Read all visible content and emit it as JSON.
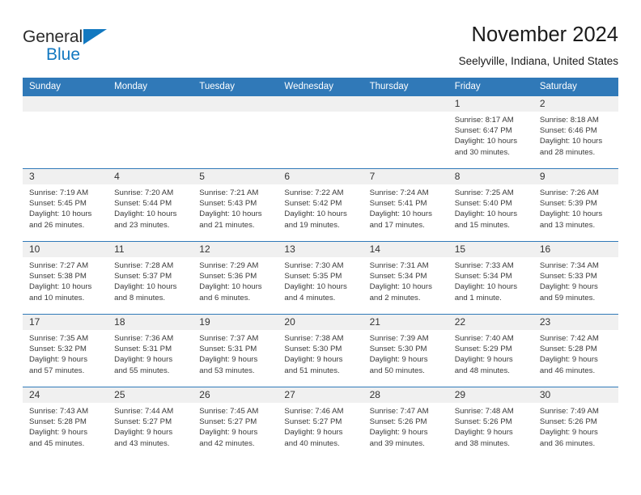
{
  "brand": {
    "name_part1": "General",
    "name_part2": "Blue",
    "triangle_color": "#1278c0"
  },
  "header": {
    "title": "November 2024",
    "subtitle": "Seelyville, Indiana, United States",
    "accent_color": "#3079b8"
  },
  "weekday_headers": [
    "Sunday",
    "Monday",
    "Tuesday",
    "Wednesday",
    "Thursday",
    "Friday",
    "Saturday"
  ],
  "labels": {
    "sunrise_prefix": "Sunrise:",
    "sunset_prefix": "Sunset:",
    "daylight_prefix": "Daylight:"
  },
  "weeks": [
    [
      {
        "day": "",
        "sunrise": "",
        "sunset": "",
        "daylight_line1": "",
        "daylight_line2": "",
        "empty": true
      },
      {
        "day": "",
        "sunrise": "",
        "sunset": "",
        "daylight_line1": "",
        "daylight_line2": "",
        "empty": true
      },
      {
        "day": "",
        "sunrise": "",
        "sunset": "",
        "daylight_line1": "",
        "daylight_line2": "",
        "empty": true
      },
      {
        "day": "",
        "sunrise": "",
        "sunset": "",
        "daylight_line1": "",
        "daylight_line2": "",
        "empty": true
      },
      {
        "day": "",
        "sunrise": "",
        "sunset": "",
        "daylight_line1": "",
        "daylight_line2": "",
        "empty": true
      },
      {
        "day": "1",
        "sunrise": "Sunrise: 8:17 AM",
        "sunset": "Sunset: 6:47 PM",
        "daylight_line1": "Daylight: 10 hours",
        "daylight_line2": "and 30 minutes.",
        "empty": false
      },
      {
        "day": "2",
        "sunrise": "Sunrise: 8:18 AM",
        "sunset": "Sunset: 6:46 PM",
        "daylight_line1": "Daylight: 10 hours",
        "daylight_line2": "and 28 minutes.",
        "empty": false
      }
    ],
    [
      {
        "day": "3",
        "sunrise": "Sunrise: 7:19 AM",
        "sunset": "Sunset: 5:45 PM",
        "daylight_line1": "Daylight: 10 hours",
        "daylight_line2": "and 26 minutes.",
        "empty": false
      },
      {
        "day": "4",
        "sunrise": "Sunrise: 7:20 AM",
        "sunset": "Sunset: 5:44 PM",
        "daylight_line1": "Daylight: 10 hours",
        "daylight_line2": "and 23 minutes.",
        "empty": false
      },
      {
        "day": "5",
        "sunrise": "Sunrise: 7:21 AM",
        "sunset": "Sunset: 5:43 PM",
        "daylight_line1": "Daylight: 10 hours",
        "daylight_line2": "and 21 minutes.",
        "empty": false
      },
      {
        "day": "6",
        "sunrise": "Sunrise: 7:22 AM",
        "sunset": "Sunset: 5:42 PM",
        "daylight_line1": "Daylight: 10 hours",
        "daylight_line2": "and 19 minutes.",
        "empty": false
      },
      {
        "day": "7",
        "sunrise": "Sunrise: 7:24 AM",
        "sunset": "Sunset: 5:41 PM",
        "daylight_line1": "Daylight: 10 hours",
        "daylight_line2": "and 17 minutes.",
        "empty": false
      },
      {
        "day": "8",
        "sunrise": "Sunrise: 7:25 AM",
        "sunset": "Sunset: 5:40 PM",
        "daylight_line1": "Daylight: 10 hours",
        "daylight_line2": "and 15 minutes.",
        "empty": false
      },
      {
        "day": "9",
        "sunrise": "Sunrise: 7:26 AM",
        "sunset": "Sunset: 5:39 PM",
        "daylight_line1": "Daylight: 10 hours",
        "daylight_line2": "and 13 minutes.",
        "empty": false
      }
    ],
    [
      {
        "day": "10",
        "sunrise": "Sunrise: 7:27 AM",
        "sunset": "Sunset: 5:38 PM",
        "daylight_line1": "Daylight: 10 hours",
        "daylight_line2": "and 10 minutes.",
        "empty": false
      },
      {
        "day": "11",
        "sunrise": "Sunrise: 7:28 AM",
        "sunset": "Sunset: 5:37 PM",
        "daylight_line1": "Daylight: 10 hours",
        "daylight_line2": "and 8 minutes.",
        "empty": false
      },
      {
        "day": "12",
        "sunrise": "Sunrise: 7:29 AM",
        "sunset": "Sunset: 5:36 PM",
        "daylight_line1": "Daylight: 10 hours",
        "daylight_line2": "and 6 minutes.",
        "empty": false
      },
      {
        "day": "13",
        "sunrise": "Sunrise: 7:30 AM",
        "sunset": "Sunset: 5:35 PM",
        "daylight_line1": "Daylight: 10 hours",
        "daylight_line2": "and 4 minutes.",
        "empty": false
      },
      {
        "day": "14",
        "sunrise": "Sunrise: 7:31 AM",
        "sunset": "Sunset: 5:34 PM",
        "daylight_line1": "Daylight: 10 hours",
        "daylight_line2": "and 2 minutes.",
        "empty": false
      },
      {
        "day": "15",
        "sunrise": "Sunrise: 7:33 AM",
        "sunset": "Sunset: 5:34 PM",
        "daylight_line1": "Daylight: 10 hours",
        "daylight_line2": "and 1 minute.",
        "empty": false
      },
      {
        "day": "16",
        "sunrise": "Sunrise: 7:34 AM",
        "sunset": "Sunset: 5:33 PM",
        "daylight_line1": "Daylight: 9 hours",
        "daylight_line2": "and 59 minutes.",
        "empty": false
      }
    ],
    [
      {
        "day": "17",
        "sunrise": "Sunrise: 7:35 AM",
        "sunset": "Sunset: 5:32 PM",
        "daylight_line1": "Daylight: 9 hours",
        "daylight_line2": "and 57 minutes.",
        "empty": false
      },
      {
        "day": "18",
        "sunrise": "Sunrise: 7:36 AM",
        "sunset": "Sunset: 5:31 PM",
        "daylight_line1": "Daylight: 9 hours",
        "daylight_line2": "and 55 minutes.",
        "empty": false
      },
      {
        "day": "19",
        "sunrise": "Sunrise: 7:37 AM",
        "sunset": "Sunset: 5:31 PM",
        "daylight_line1": "Daylight: 9 hours",
        "daylight_line2": "and 53 minutes.",
        "empty": false
      },
      {
        "day": "20",
        "sunrise": "Sunrise: 7:38 AM",
        "sunset": "Sunset: 5:30 PM",
        "daylight_line1": "Daylight: 9 hours",
        "daylight_line2": "and 51 minutes.",
        "empty": false
      },
      {
        "day": "21",
        "sunrise": "Sunrise: 7:39 AM",
        "sunset": "Sunset: 5:30 PM",
        "daylight_line1": "Daylight: 9 hours",
        "daylight_line2": "and 50 minutes.",
        "empty": false
      },
      {
        "day": "22",
        "sunrise": "Sunrise: 7:40 AM",
        "sunset": "Sunset: 5:29 PM",
        "daylight_line1": "Daylight: 9 hours",
        "daylight_line2": "and 48 minutes.",
        "empty": false
      },
      {
        "day": "23",
        "sunrise": "Sunrise: 7:42 AM",
        "sunset": "Sunset: 5:28 PM",
        "daylight_line1": "Daylight: 9 hours",
        "daylight_line2": "and 46 minutes.",
        "empty": false
      }
    ],
    [
      {
        "day": "24",
        "sunrise": "Sunrise: 7:43 AM",
        "sunset": "Sunset: 5:28 PM",
        "daylight_line1": "Daylight: 9 hours",
        "daylight_line2": "and 45 minutes.",
        "empty": false
      },
      {
        "day": "25",
        "sunrise": "Sunrise: 7:44 AM",
        "sunset": "Sunset: 5:27 PM",
        "daylight_line1": "Daylight: 9 hours",
        "daylight_line2": "and 43 minutes.",
        "empty": false
      },
      {
        "day": "26",
        "sunrise": "Sunrise: 7:45 AM",
        "sunset": "Sunset: 5:27 PM",
        "daylight_line1": "Daylight: 9 hours",
        "daylight_line2": "and 42 minutes.",
        "empty": false
      },
      {
        "day": "27",
        "sunrise": "Sunrise: 7:46 AM",
        "sunset": "Sunset: 5:27 PM",
        "daylight_line1": "Daylight: 9 hours",
        "daylight_line2": "and 40 minutes.",
        "empty": false
      },
      {
        "day": "28",
        "sunrise": "Sunrise: 7:47 AM",
        "sunset": "Sunset: 5:26 PM",
        "daylight_line1": "Daylight: 9 hours",
        "daylight_line2": "and 39 minutes.",
        "empty": false
      },
      {
        "day": "29",
        "sunrise": "Sunrise: 7:48 AM",
        "sunset": "Sunset: 5:26 PM",
        "daylight_line1": "Daylight: 9 hours",
        "daylight_line2": "and 38 minutes.",
        "empty": false
      },
      {
        "day": "30",
        "sunrise": "Sunrise: 7:49 AM",
        "sunset": "Sunset: 5:26 PM",
        "daylight_line1": "Daylight: 9 hours",
        "daylight_line2": "and 36 minutes.",
        "empty": false
      }
    ]
  ]
}
